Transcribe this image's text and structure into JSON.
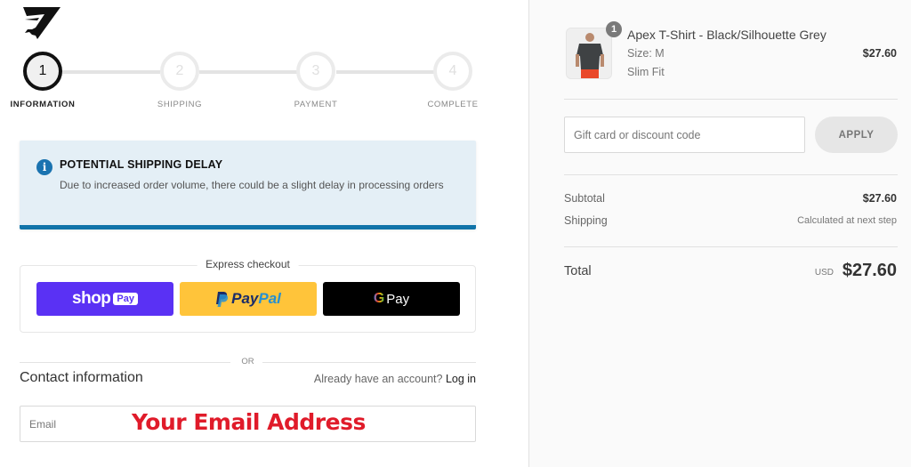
{
  "brand": {
    "logo_icon": "gymshark-logo-icon"
  },
  "stepper": {
    "steps": [
      {
        "number": "1",
        "label": "INFORMATION",
        "state": "active"
      },
      {
        "number": "2",
        "label": "SHIPPING",
        "state": "inactive"
      },
      {
        "number": "3",
        "label": "PAYMENT",
        "state": "inactive"
      },
      {
        "number": "4",
        "label": "COMPLETE",
        "state": "inactive"
      }
    ]
  },
  "notice": {
    "icon": "info-icon",
    "icon_glyph": "i",
    "title": "POTENTIAL SHIPPING DELAY",
    "text": "Due to increased order volume, there could be a slight delay in processing orders",
    "accent_color": "#1174a9"
  },
  "express_checkout": {
    "title": "Express checkout",
    "shop_pay": {
      "shop": "shop",
      "pay": "Pay",
      "color": "#5a31f4"
    },
    "paypal": {
      "pay": "Pay",
      "pal": "Pal",
      "color": "#ffc43a"
    },
    "gpay": {
      "g": "G",
      "pay": "Pay",
      "color": "#000000"
    }
  },
  "divider_text": "OR",
  "contact": {
    "title": "Contact information",
    "account_prompt": "Already have an account?",
    "login_link": "Log in",
    "email_placeholder": "Email",
    "email_annotation": "Your Email Address",
    "annotation_color": "#e01b2a"
  },
  "order_summary": {
    "item": {
      "quantity": "1",
      "name": "Apex T-Shirt - Black/Silhouette Grey",
      "size": "Size: M",
      "fit": "Slim Fit",
      "price": "$27.60"
    },
    "discount": {
      "placeholder": "Gift card or discount code",
      "apply_label": "APPLY"
    },
    "subtotal": {
      "label": "Subtotal",
      "value": "$27.60"
    },
    "shipping": {
      "label": "Shipping",
      "value": "Calculated at next step"
    },
    "total": {
      "label": "Total",
      "currency": "USD",
      "value": "$27.60"
    }
  }
}
